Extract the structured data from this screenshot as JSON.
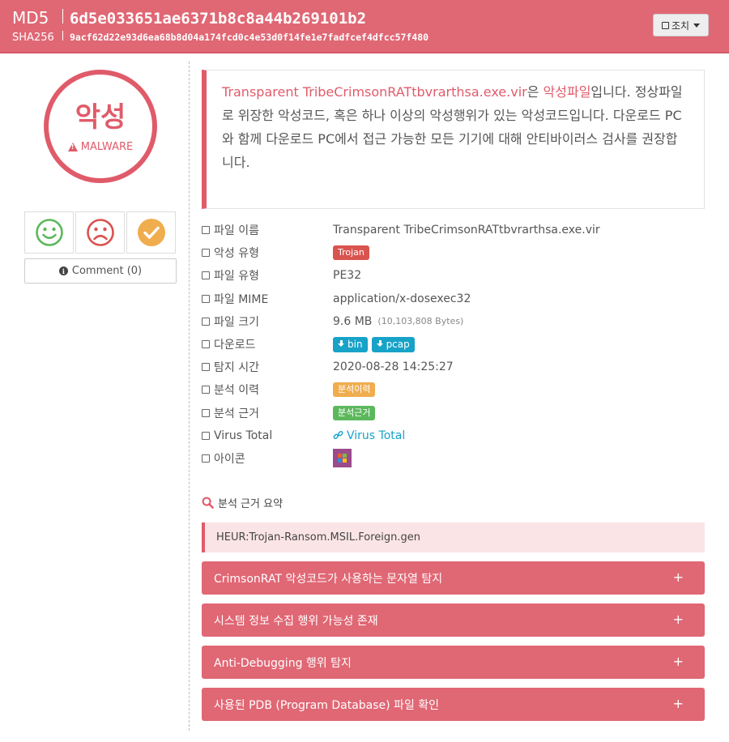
{
  "header": {
    "md5_label": "MD5",
    "md5_value": "6d5e033651ae6371b8c8a44b269101b2",
    "sha256_label": "SHA256",
    "sha256_value": "9acf62d22e93d6ea68b8d04a174fcd0c4e53d0f14fe1e7fadfcef4dfcc57f480",
    "action_label": "조치"
  },
  "verdict": {
    "title": "악성",
    "subtitle": "MALWARE",
    "color": "#e05b6a"
  },
  "votes": {
    "good_icon": "smile-icon",
    "bad_icon": "frown-icon",
    "confirm_icon": "check-circle-icon"
  },
  "comment": {
    "label": "Comment (0)"
  },
  "description": {
    "filename": "Transparent TribeCrimsonRATtbvrarthsa.exe.vir",
    "particle": "은 ",
    "verdict_word": "악성파일",
    "rest": "입니다. 정상파일로 위장한 악성코드, 혹은 하나 이상의 악성행위가 있는 악성코드입니다. 다운로드 PC와 함께 다운로드 PC에서 접근 가능한 모든 기기에 대해 안티바이러스 검사를 권장합니다."
  },
  "info": {
    "filename_label": "파일 이름",
    "filename_value": "Transparent TribeCrimsonRATtbvrarthsa.exe.vir",
    "malware_type_label": "악성 유형",
    "malware_type_value": "Trojan",
    "file_type_label": "파일 유형",
    "file_type_value": "PE32",
    "mime_label": "파일 MIME",
    "mime_value": "application/x-dosexec32",
    "size_label": "파일 크기",
    "size_value": "9.6 MB",
    "size_bytes": "(10,103,808 Bytes)",
    "download_label": "다운로드",
    "download_bin": "bin",
    "download_pcap": "pcap",
    "detect_time_label": "탐지 시간",
    "detect_time_value": "2020-08-28 14:25:27",
    "history_label": "분석 이력",
    "history_badge": "분석이력",
    "basis_label": "분석 근거",
    "basis_badge": "분석근거",
    "vt_label": "Virus Total",
    "vt_link": "Virus Total",
    "icon_label": "아이콘"
  },
  "summary": {
    "heading": "분석 근거 요약",
    "detection": "HEUR:Trojan-Ransom.MSIL.Foreign.gen",
    "items": [
      "CrimsonRAT 악성코드가 사용하는 문자열 탐지",
      "시스템 정보 수집 행위 가능성 존재",
      "Anti-Debugging 행위 탐지",
      "사용된 PDB (Program Database) 파일 확인"
    ],
    "expand_symbol": "+"
  }
}
